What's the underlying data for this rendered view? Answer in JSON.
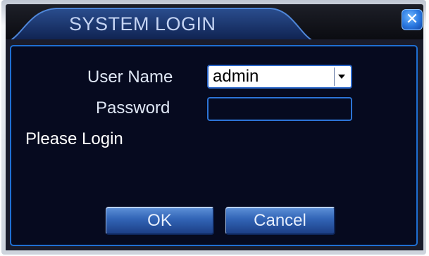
{
  "dialog": {
    "title": "SYSTEM LOGIN",
    "close_symbol": "✕",
    "close_icon": "close-icon"
  },
  "form": {
    "user_name_label": "User Name",
    "user_name_value": "admin",
    "password_label": "Password",
    "password_value": "",
    "status_text": "Please Login"
  },
  "buttons": {
    "ok_label": "OK",
    "cancel_label": "Cancel"
  },
  "colors": {
    "panel_bg": "#060a1f",
    "border_accent": "#1f6fd2",
    "button_blue": "#3366b8",
    "title_text": "#c5d4f3"
  }
}
